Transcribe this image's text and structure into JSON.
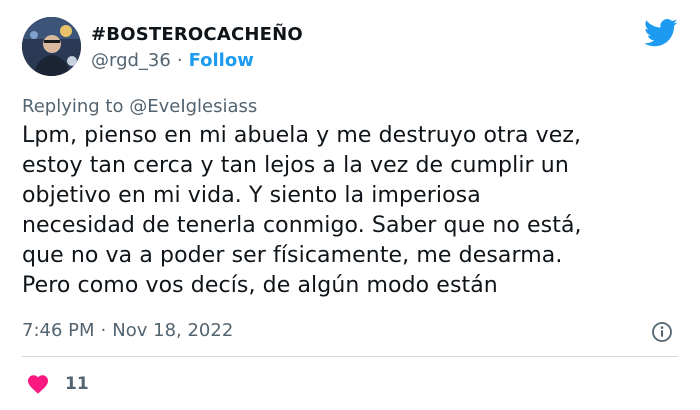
{
  "author": {
    "display_name": "#BOSTEROCACHEÑO",
    "handle": "@rgd_36",
    "separator": "·",
    "follow_label": "Follow"
  },
  "reply": {
    "prefix": "Replying to",
    "mention": "@EveIglesiass"
  },
  "tweet": {
    "lines": [
      "Lpm, pienso en mi abuela y me destruyo otra vez,",
      "estoy tan cerca y tan lejos a la vez de cumplir un",
      "objetivo en mi vida. Y siento la imperiosa",
      "necesidad de tenerla conmigo. Saber que no está,",
      "que no va a poder ser físicamente, me desarma.",
      "Pero como vos decís, de algún modo están"
    ],
    "time": "7:46 PM",
    "separator": "·",
    "date": "Nov 18, 2022"
  },
  "engagement": {
    "likes": "11"
  },
  "colors": {
    "accent": "#1d9bf0",
    "text": "#0f1419",
    "muted": "#536471",
    "heart": "#f91880",
    "divider": "#cfd9de"
  },
  "icons": {
    "brand": "twitter-bird-icon",
    "info": "info-circle-icon",
    "like": "heart-icon"
  }
}
